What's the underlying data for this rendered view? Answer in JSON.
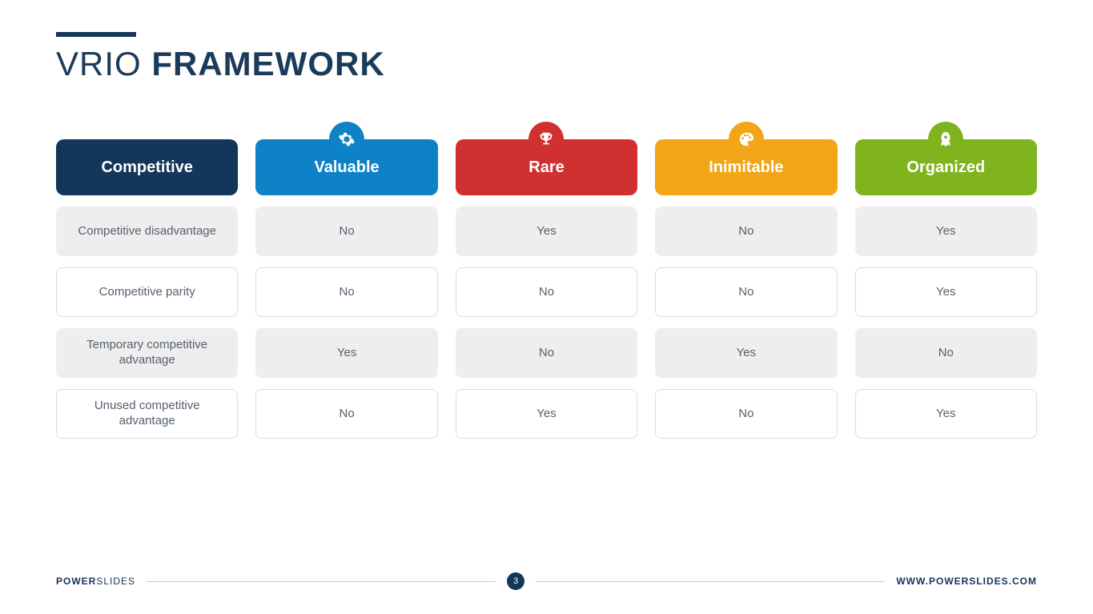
{
  "title": {
    "thin": "VRIO",
    "bold": "FRAMEWORK"
  },
  "chart_data": {
    "type": "table",
    "title": "VRIO Framework",
    "columns": [
      {
        "label": "Competitive",
        "color": "#14365a",
        "icon": null
      },
      {
        "label": "Valuable",
        "color": "#0d82c7",
        "icon": "gear"
      },
      {
        "label": "Rare",
        "color": "#d0302f",
        "icon": "trophy"
      },
      {
        "label": "Inimitable",
        "color": "#f2a516",
        "icon": "palette"
      },
      {
        "label": "Organized",
        "color": "#7fb41e",
        "icon": "rocket"
      }
    ],
    "rows": [
      {
        "label": "Competitive disadvantage",
        "values": [
          "No",
          "Yes",
          "No",
          "Yes"
        ],
        "shade": true
      },
      {
        "label": "Competitive parity",
        "values": [
          "No",
          "No",
          "No",
          "Yes"
        ],
        "shade": false
      },
      {
        "label": "Temporary competitive advantage",
        "values": [
          "Yes",
          "No",
          "Yes",
          "No"
        ],
        "shade": true
      },
      {
        "label": "Unused competitive advantage",
        "values": [
          "No",
          "Yes",
          "No",
          "Yes"
        ],
        "shade": false
      }
    ]
  },
  "footer": {
    "brand_thin": "POWER",
    "brand_bold": "SLIDES",
    "page": "3",
    "url": "WWW.POWERSLIDES.COM"
  }
}
